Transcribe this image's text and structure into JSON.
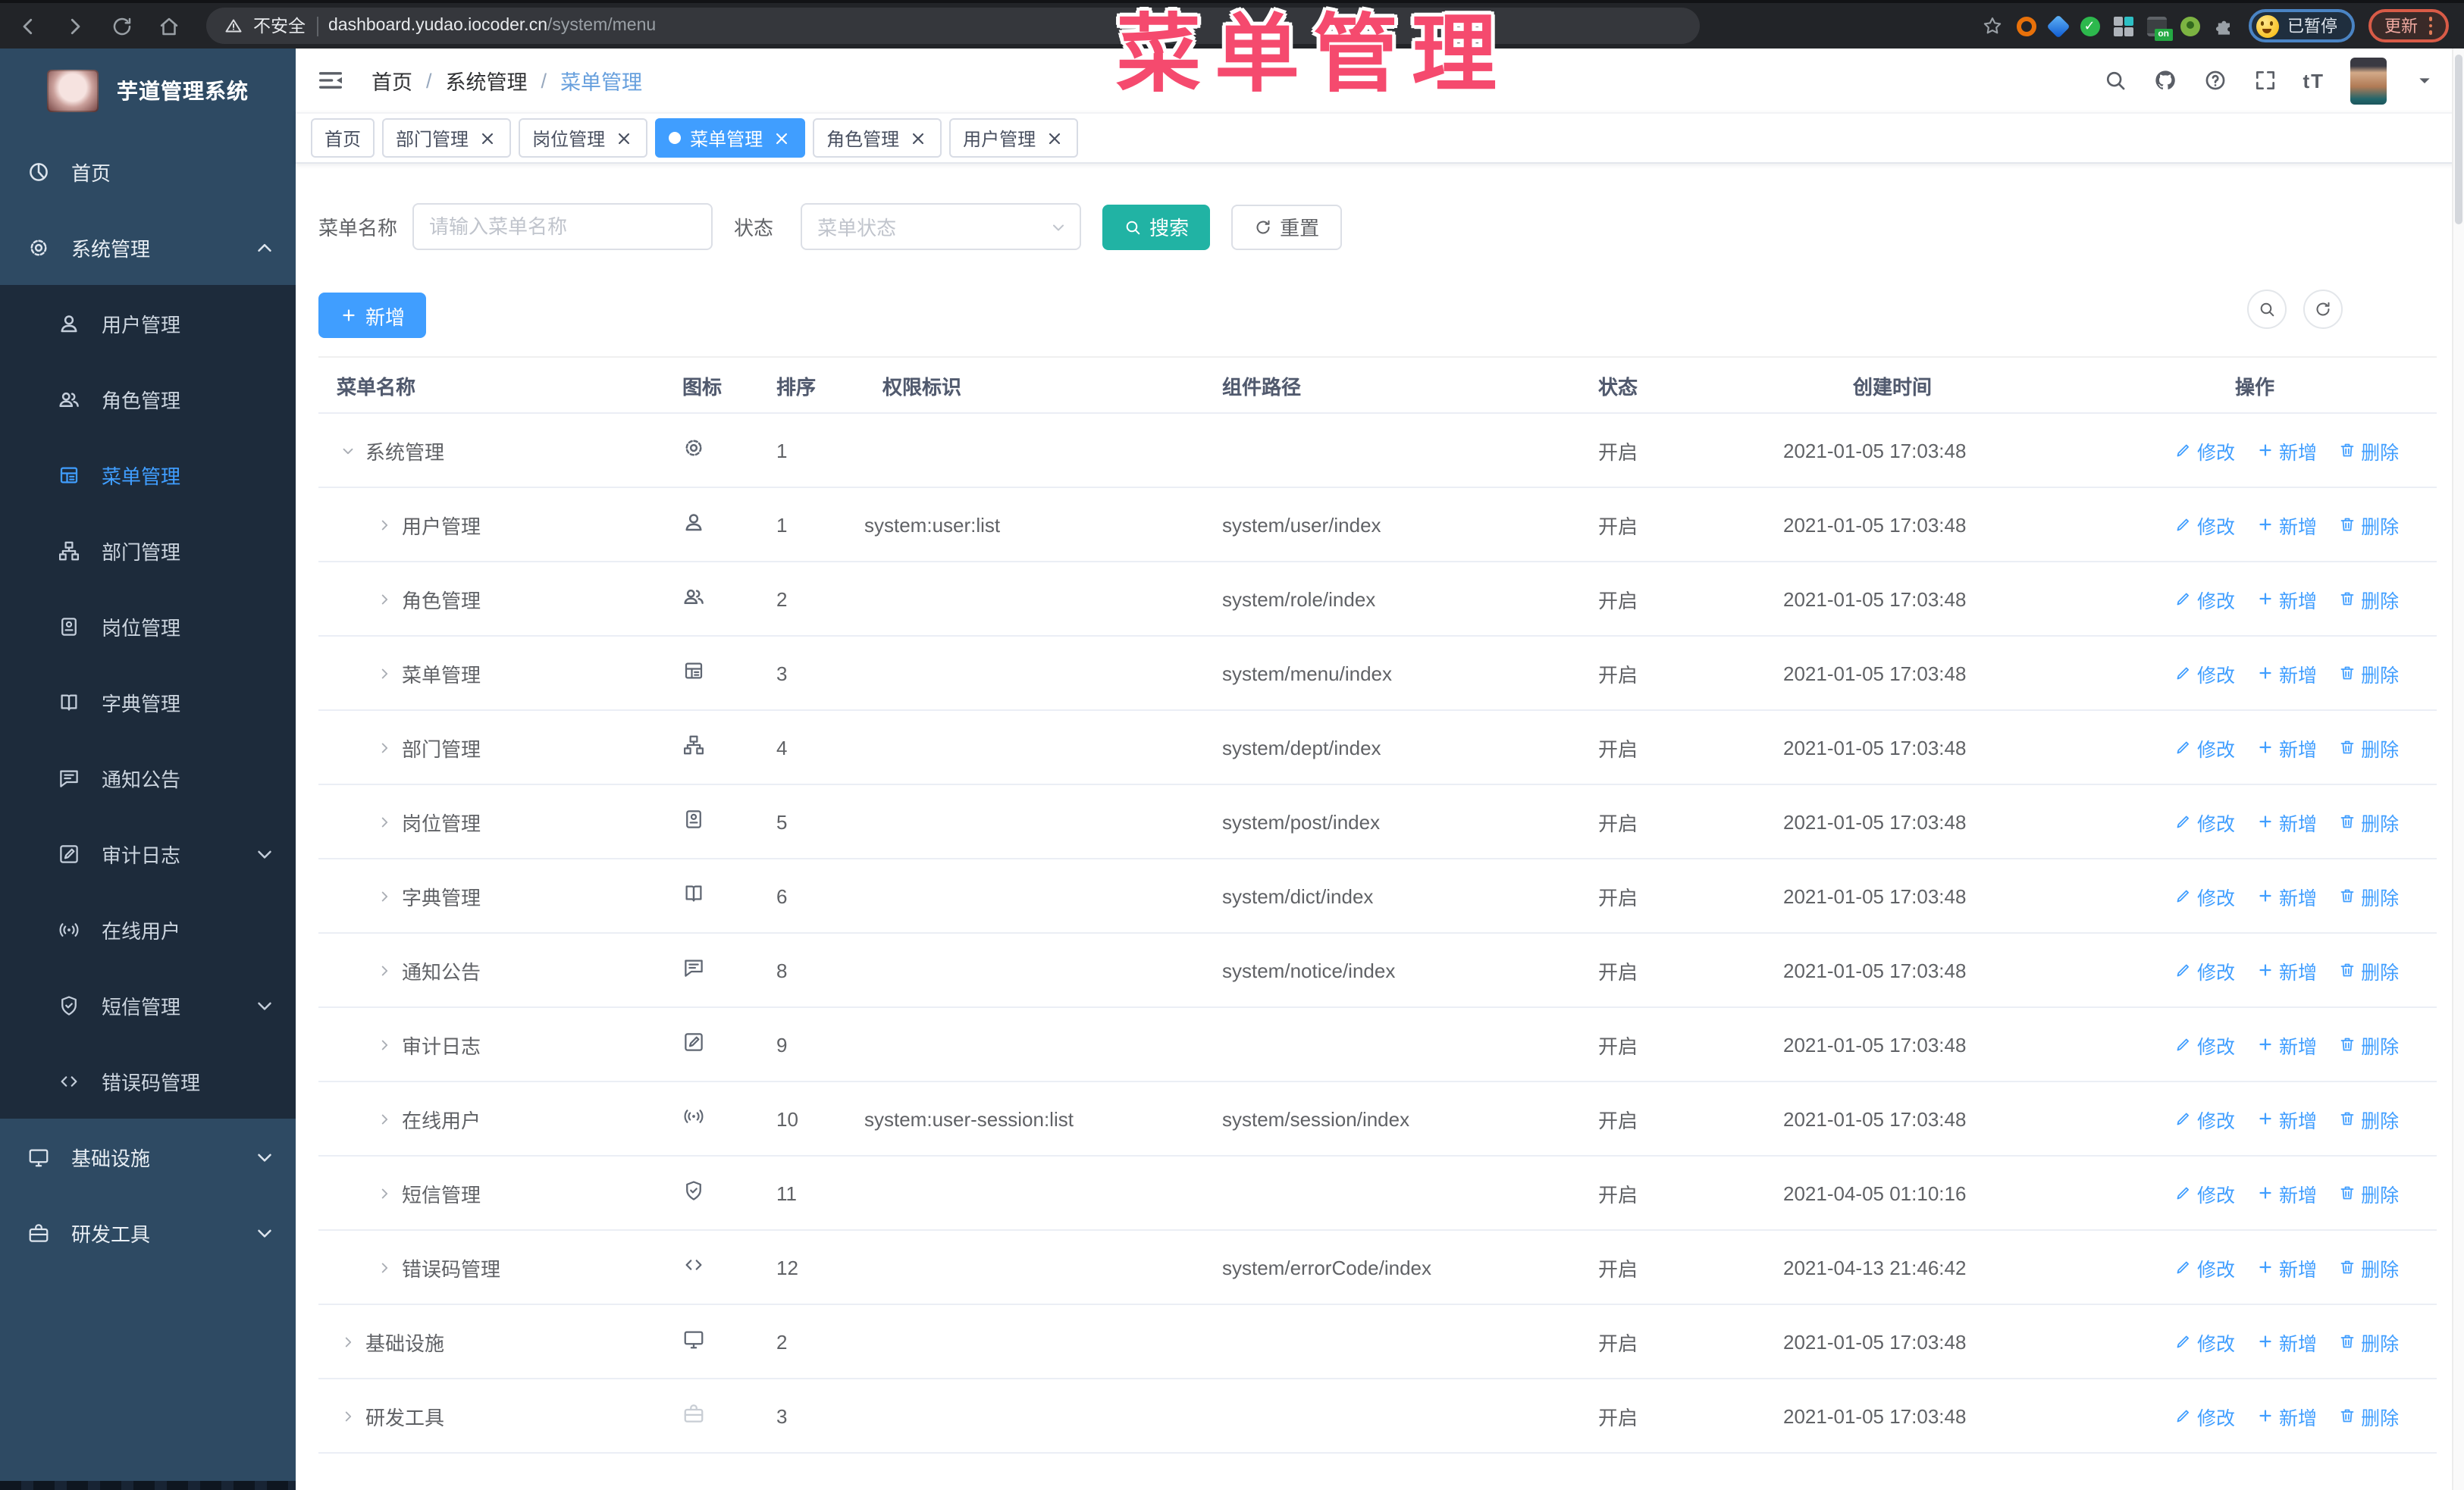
{
  "browser": {
    "security_label": "不安全",
    "url_host": "dashboard.yudao.iocoder.cn",
    "url_path": "/system/menu",
    "paused_label": "已暂停",
    "update_label": "更新"
  },
  "overlay": {
    "title": "菜单管理"
  },
  "sidebar": {
    "app_title": "芋道管理系统",
    "items": [
      {
        "label": "首页",
        "icon": "dashboard"
      },
      {
        "label": "系统管理",
        "icon": "gear",
        "expanded": true,
        "chevron": "up",
        "children": [
          {
            "label": "用户管理",
            "icon": "user"
          },
          {
            "label": "角色管理",
            "icon": "users"
          },
          {
            "label": "菜单管理",
            "icon": "list",
            "active": true
          },
          {
            "label": "部门管理",
            "icon": "sitemap"
          },
          {
            "label": "岗位管理",
            "icon": "badge"
          },
          {
            "label": "字典管理",
            "icon": "book"
          },
          {
            "label": "通知公告",
            "icon": "comment"
          },
          {
            "label": "审计日志",
            "icon": "edit",
            "chevron": "down"
          },
          {
            "label": "在线用户",
            "icon": "online"
          },
          {
            "label": "短信管理",
            "icon": "shield",
            "chevron": "down"
          },
          {
            "label": "错误码管理",
            "icon": "code"
          }
        ]
      },
      {
        "label": "基础设施",
        "icon": "monitor",
        "chevron": "down"
      },
      {
        "label": "研发工具",
        "icon": "tool",
        "chevron": "down"
      }
    ]
  },
  "header": {
    "breadcrumb": [
      "首页",
      "系统管理",
      "菜单管理"
    ]
  },
  "tabs": [
    {
      "label": "首页",
      "closable": false,
      "active": false
    },
    {
      "label": "部门管理",
      "closable": true,
      "active": false
    },
    {
      "label": "岗位管理",
      "closable": true,
      "active": false
    },
    {
      "label": "菜单管理",
      "closable": true,
      "active": true
    },
    {
      "label": "角色管理",
      "closable": true,
      "active": false
    },
    {
      "label": "用户管理",
      "closable": true,
      "active": false
    }
  ],
  "filters": {
    "name_label": "菜单名称",
    "name_placeholder": "请输入菜单名称",
    "status_label": "状态",
    "status_placeholder": "菜单状态",
    "search_label": "搜索",
    "reset_label": "重置"
  },
  "toolbar": {
    "add_label": "新增"
  },
  "table": {
    "headers": [
      "菜单名称",
      "图标",
      "排序",
      "权限标识",
      "组件路径",
      "状态",
      "创建时间",
      "操作"
    ],
    "action_labels": {
      "edit": "修改",
      "add": "新增",
      "delete": "删除"
    },
    "rows": [
      {
        "name": "系统管理",
        "icon": "gear",
        "sort": "1",
        "perm": "",
        "path": "",
        "status": "开启",
        "time": "2021-01-05 17:03:48",
        "level": 0,
        "expanded": true
      },
      {
        "name": "用户管理",
        "icon": "user",
        "sort": "1",
        "perm": "system:user:list",
        "path": "system/user/index",
        "status": "开启",
        "time": "2021-01-05 17:03:48",
        "level": 1
      },
      {
        "name": "角色管理",
        "icon": "users",
        "sort": "2",
        "perm": "",
        "path": "system/role/index",
        "status": "开启",
        "time": "2021-01-05 17:03:48",
        "level": 1
      },
      {
        "name": "菜单管理",
        "icon": "list",
        "sort": "3",
        "perm": "",
        "path": "system/menu/index",
        "status": "开启",
        "time": "2021-01-05 17:03:48",
        "level": 1
      },
      {
        "name": "部门管理",
        "icon": "sitemap",
        "sort": "4",
        "perm": "",
        "path": "system/dept/index",
        "status": "开启",
        "time": "2021-01-05 17:03:48",
        "level": 1
      },
      {
        "name": "岗位管理",
        "icon": "badge",
        "sort": "5",
        "perm": "",
        "path": "system/post/index",
        "status": "开启",
        "time": "2021-01-05 17:03:48",
        "level": 1
      },
      {
        "name": "字典管理",
        "icon": "book",
        "sort": "6",
        "perm": "",
        "path": "system/dict/index",
        "status": "开启",
        "time": "2021-01-05 17:03:48",
        "level": 1
      },
      {
        "name": "通知公告",
        "icon": "comment",
        "sort": "8",
        "perm": "",
        "path": "system/notice/index",
        "status": "开启",
        "time": "2021-01-05 17:03:48",
        "level": 1
      },
      {
        "name": "审计日志",
        "icon": "edit",
        "sort": "9",
        "perm": "",
        "path": "",
        "status": "开启",
        "time": "2021-01-05 17:03:48",
        "level": 1
      },
      {
        "name": "在线用户",
        "icon": "online",
        "sort": "10",
        "perm": "system:user-session:list",
        "path": "system/session/index",
        "status": "开启",
        "time": "2021-01-05 17:03:48",
        "level": 1
      },
      {
        "name": "短信管理",
        "icon": "shield",
        "sort": "11",
        "perm": "",
        "path": "",
        "status": "开启",
        "time": "2021-04-05 01:10:16",
        "level": 1
      },
      {
        "name": "错误码管理",
        "icon": "code",
        "sort": "12",
        "perm": "",
        "path": "system/errorCode/index",
        "status": "开启",
        "time": "2021-04-13 21:46:42",
        "level": 1
      },
      {
        "name": "基础设施",
        "icon": "monitor",
        "sort": "2",
        "perm": "",
        "path": "",
        "status": "开启",
        "time": "2021-01-05 17:03:48",
        "level": 0
      },
      {
        "name": "研发工具",
        "icon": "tool",
        "sort": "3",
        "perm": "",
        "path": "",
        "status": "开启",
        "time": "2021-01-05 17:03:48",
        "level": 0,
        "muted_icon": true
      }
    ]
  },
  "colors": {
    "accent": "#409eff",
    "search_teal": "#21b3a4",
    "overlay_pink": "#f54a6e",
    "sidebar_light": "#2e4a63",
    "sidebar_dark": "#1d2b3b"
  }
}
